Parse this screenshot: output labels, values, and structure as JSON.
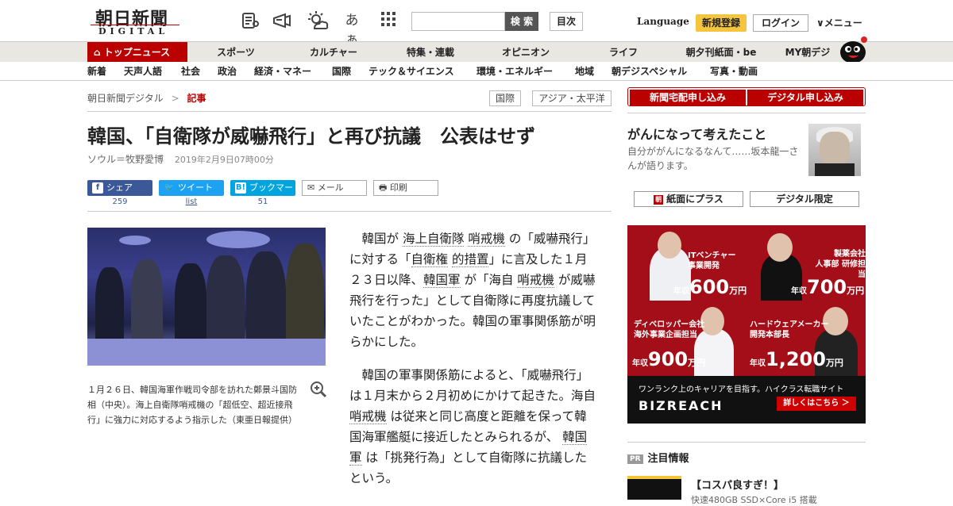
{
  "header": {
    "logo_main": "朝日新聞",
    "logo_sub": "DIGITAL",
    "search_button": "検 索",
    "toc_button": "目次",
    "language": "Language",
    "register": "新規登録",
    "login": "ログイン",
    "menu": "メニュー",
    "icons": [
      "newspaper-icon",
      "megaphone-icon",
      "weather-icon",
      "text-size-icon",
      "grid-icon"
    ],
    "text_size_glyph": "あぁ"
  },
  "nav_primary": {
    "top": "トップニュース",
    "items": [
      "スポーツ",
      "カルチャー",
      "特集・連載",
      "オピニオン",
      "ライフ",
      "朝夕刊紙面・be",
      "MY朝デジ"
    ]
  },
  "nav_secondary": {
    "items": [
      "新着",
      "天声人語",
      "社会",
      "政治",
      "経済・マネー",
      "国際",
      "テック＆サイエンス",
      "環境・エネルギー",
      "地域",
      "朝デジスペシャル",
      "写真・動画"
    ]
  },
  "breadcrumb": {
    "home": "朝日新聞デジタル",
    "sep": ">",
    "current": "記事"
  },
  "tags": [
    "国際",
    "アジア・太平洋"
  ],
  "article": {
    "title": "韓国、「自衛隊が威嚇飛行」と再び抗議　公表はせず",
    "author": "ソウル＝牧野愛博",
    "date": "2019年2月9日07時00分",
    "share": {
      "facebook": "シェア",
      "facebook_count": "259",
      "twitter": "ツイート",
      "twitter_count": "list",
      "hatena": "ブックマーク",
      "hatena_count": "51",
      "mail": "メール",
      "print": "印刷"
    },
    "caption": "１月２６日、韓国海軍作戦司令部を訪れた鄭景斗国防相（中央）。海上自衛隊哨戒機の「超低空、超近接飛行」に強力に対応するよう指示した（東亜日報提供）",
    "p1": {
      "a": "韓国が",
      "k1": "海上自衛隊",
      "k2": "哨戒機",
      "b": "の「威嚇飛行」に対する「",
      "k3": "自衛権",
      "k4": "的措置",
      "c": "」に言及した１月２３日以降、",
      "k5": "韓国軍",
      "d": "が「海自",
      "k6": "哨戒機",
      "e": "が威嚇飛行を行った」として自衛隊に再度抗議していたことがわかった。韓国の軍事関係筋が明らかにした。"
    },
    "p2": {
      "a": "韓国の軍事関係筋によると、「威嚇飛行」は１月末から２月初めにかけて起きた。海自",
      "k1": "哨戒機",
      "b": "は従来と同じ高度と距離を保って韓国海軍艦艇に接近したとみられるが、",
      "k2": "韓国軍",
      "c": "は「挑発行為」として自衛隊に抗議したという。"
    }
  },
  "sidebar": {
    "sub_home": "新聞宅配申し込み",
    "sub_digital": "デジタル申し込み",
    "promo_title": "がんになって考えたこと",
    "promo_desc": "自分ががんになるなんて……坂本龍一さんが語ります。",
    "btn_paper": "紙面にプラス",
    "btn_digital": "デジタル限定",
    "ad": {
      "cells": [
        {
          "role": "ITベンチャー\n事業開発",
          "prefix": "年収",
          "amount": "600",
          "unit": "万円"
        },
        {
          "role": "製薬会社\n人事部 研修担当",
          "prefix": "年収",
          "amount": "700",
          "unit": "万円"
        },
        {
          "role": "ディベロッパー会社\n海外事業企画担当",
          "prefix": "年収",
          "amount": "900",
          "unit": "万円"
        },
        {
          "role": "ハードウェアメーカー\n開発本部長",
          "prefix": "年収",
          "amount": "1,200",
          "unit": "万円"
        }
      ],
      "tagline": "ワンランク上のキャリアを目指す。ハイクラス転職サイト",
      "brand": "BIZREACH",
      "cta": "詳しくはこちら ＞"
    },
    "pr_badge": "PR",
    "pr_heading": "注目情報",
    "pr_title": "【コスパ良すぎ！】",
    "pr_sub": "快速480GB SSD×Core i5 搭載"
  },
  "colors": {
    "brand_red": "#bb0000",
    "register_yellow": "#f5c53d",
    "nav_bg": "#e9e7e2",
    "facebook": "#3b5998",
    "twitter": "#1da1f2",
    "hatena": "#00a4de"
  }
}
